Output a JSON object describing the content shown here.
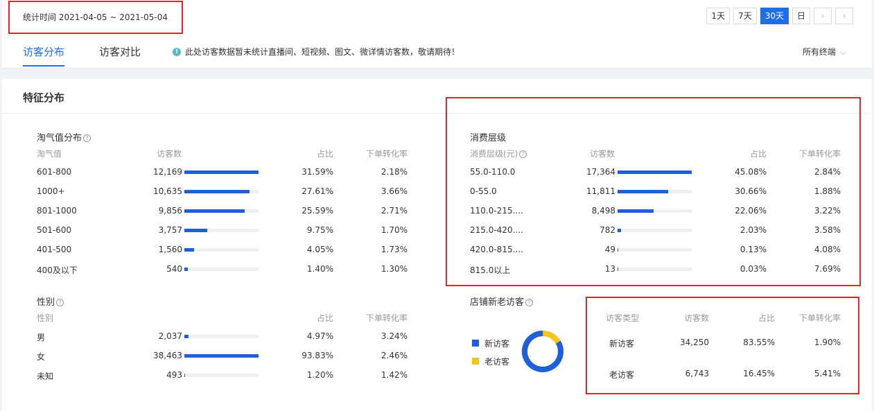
{
  "header": {
    "date_label": "统计时间 2021-04-05 ~ 2021-05-04",
    "range_buttons": [
      "1天",
      "7天",
      "30天",
      "日"
    ],
    "active_range": "30天",
    "prev_arrow": "‹",
    "next_arrow": "›"
  },
  "tabs": [
    {
      "label": "访客分布"
    },
    {
      "label": "访客对比"
    }
  ],
  "notice": {
    "icon": "info-icon",
    "text": "此处访客数据暂未统计直播间、短视频、图文、微详情访客数，敬请期待！"
  },
  "terminal_select": {
    "value": "所有终端"
  },
  "section_title": "特征分布",
  "taoqi": {
    "title": "淘气值分布",
    "headers": {
      "level": "淘气值",
      "visitors": "访客数",
      "ratio": "占比",
      "conv": "下单转化率"
    },
    "rows": [
      {
        "label": "601-800",
        "visitors": "12,169",
        "ratio": "31.59%",
        "conv": "2.18%",
        "bar": 1.0
      },
      {
        "label": "1000+",
        "visitors": "10,635",
        "ratio": "27.61%",
        "conv": "3.66%",
        "bar": 0.874
      },
      {
        "label": "801-1000",
        "visitors": "9,856",
        "ratio": "25.59%",
        "conv": "2.71%",
        "bar": 0.81
      },
      {
        "label": "501-600",
        "visitors": "3,757",
        "ratio": "9.75%",
        "conv": "1.70%",
        "bar": 0.309
      },
      {
        "label": "401-500",
        "visitors": "1,560",
        "ratio": "4.05%",
        "conv": "1.73%",
        "bar": 0.128
      },
      {
        "label": "400及以下",
        "visitors": "540",
        "ratio": "1.40%",
        "conv": "1.30%",
        "bar": 0.044
      }
    ]
  },
  "consume": {
    "title": "消费层级",
    "headers": {
      "level": "消费层级(元)",
      "visitors": "访客数",
      "ratio": "占比",
      "conv": "下单转化率"
    },
    "rows": [
      {
        "label": "55.0-110.0",
        "visitors": "17,364",
        "ratio": "45.08%",
        "conv": "2.84%",
        "bar": 1.0
      },
      {
        "label": "0-55.0",
        "visitors": "11,811",
        "ratio": "30.66%",
        "conv": "1.88%",
        "bar": 0.68
      },
      {
        "label": "110.0-215....",
        "visitors": "8,498",
        "ratio": "22.06%",
        "conv": "3.22%",
        "bar": 0.489
      },
      {
        "label": "215.0-420....",
        "visitors": "782",
        "ratio": "2.03%",
        "conv": "3.58%",
        "bar": 0.045
      },
      {
        "label": "420.0-815....",
        "visitors": "49",
        "ratio": "0.13%",
        "conv": "4.08%",
        "bar": 0.003
      },
      {
        "label": "815.0以上",
        "visitors": "13",
        "ratio": "0.03%",
        "conv": "7.69%",
        "bar": 0.001
      }
    ]
  },
  "gender": {
    "title": "性别",
    "headers": {
      "level": "性别",
      "ratio": "占比",
      "conv": "下单转化率"
    },
    "rows": [
      {
        "label": "男",
        "visitors": "2,037",
        "ratio": "4.97%",
        "conv": "3.24%",
        "bar": 0.053
      },
      {
        "label": "女",
        "visitors": "38,463",
        "ratio": "93.83%",
        "conv": "2.46%",
        "bar": 1.0
      },
      {
        "label": "未知",
        "visitors": "493",
        "ratio": "1.20%",
        "conv": "1.42%",
        "bar": 0.013
      }
    ]
  },
  "newold": {
    "title": "店铺新老访客",
    "legend": [
      {
        "label": "新访客",
        "color": "#1e5fdb"
      },
      {
        "label": "老访客",
        "color": "#f5c518"
      }
    ],
    "donut": {
      "new_share": 0.8355,
      "old_share": 0.1645
    },
    "headers": {
      "type": "访客类型",
      "visitors": "访客数",
      "ratio": "占比",
      "conv": "下单转化率"
    },
    "rows": [
      {
        "label": "新访客",
        "visitors": "34,250",
        "ratio": "83.55%",
        "conv": "1.90%"
      },
      {
        "label": "老访客",
        "visitors": "6,743",
        "ratio": "16.45%",
        "conv": "5.41%"
      }
    ]
  },
  "colors": {
    "accent": "#1e6fe6",
    "bar": "#1e5fdb",
    "highlight_box": "#e2242b"
  }
}
